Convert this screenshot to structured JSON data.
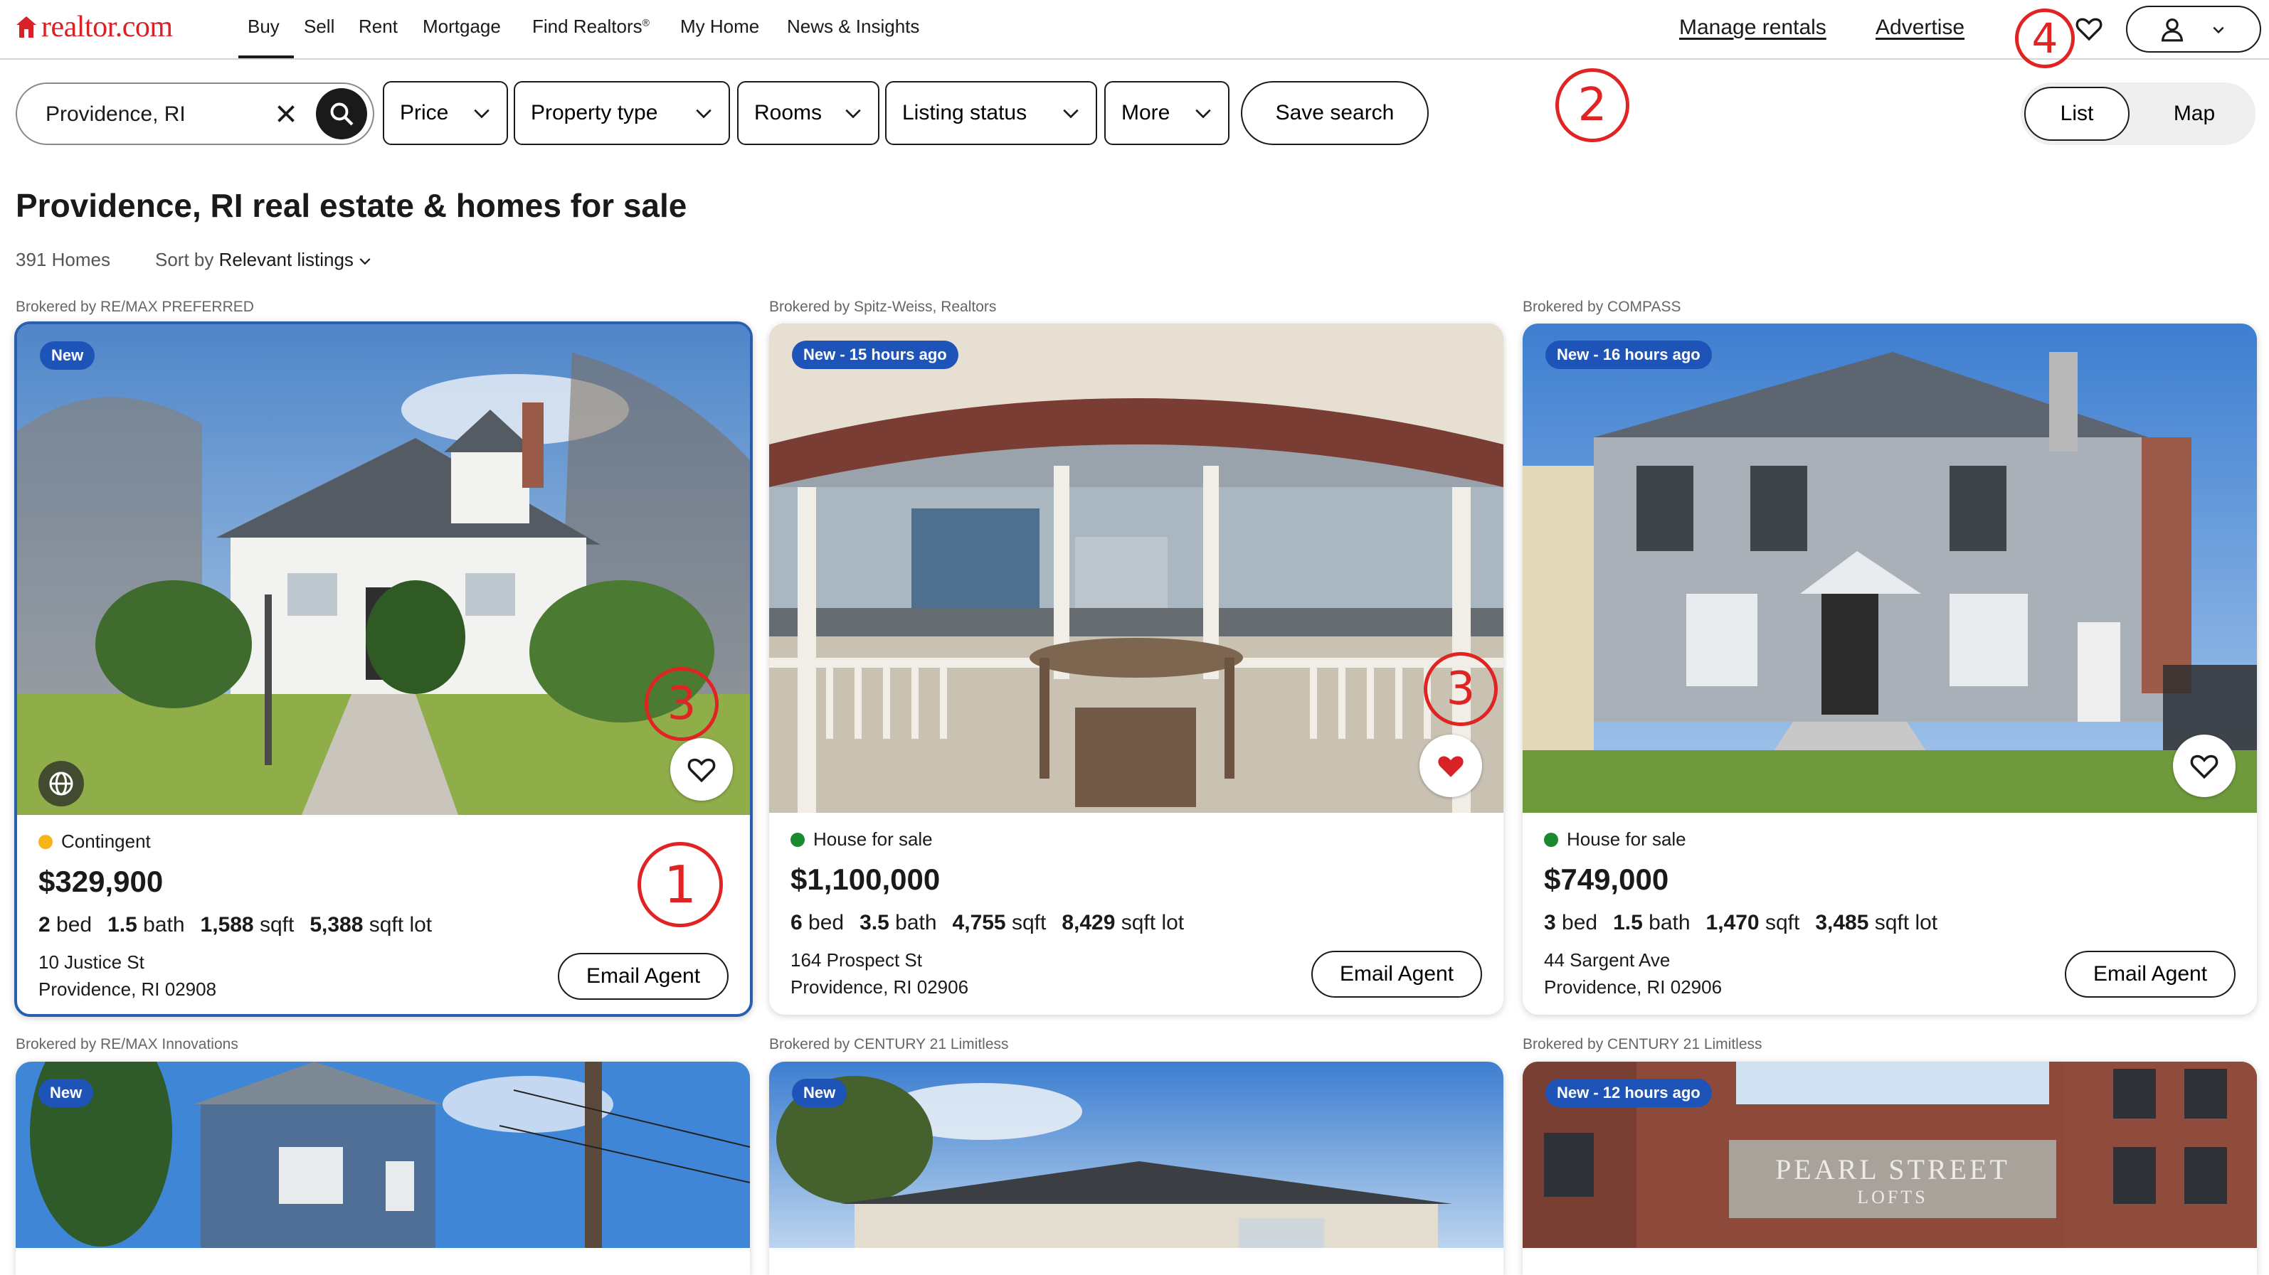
{
  "header": {
    "logo_text": "realtor.com",
    "nav": [
      "Buy",
      "Sell",
      "Rent",
      "Mortgage",
      "Find Realtors",
      "My Home",
      "News & Insights"
    ],
    "find_realtors_mark": "®",
    "manage_rentals": "Manage rentals",
    "advertise": "Advertise"
  },
  "search": {
    "value": "Providence, RI",
    "filters": [
      "Price",
      "Property type",
      "Rooms",
      "Listing status",
      "More"
    ],
    "save_label": "Save search",
    "view_list": "List",
    "view_map": "Map"
  },
  "results": {
    "title": "Providence, RI real estate & homes for sale",
    "count": "391 Homes",
    "sort_prefix": "Sort by",
    "sort_value": "Relevant listings"
  },
  "annotations": [
    "1",
    "2",
    "3",
    "3",
    "4"
  ],
  "listings": [
    {
      "broker": "Brokered by RE/MAX PREFERRED",
      "badge": "New",
      "status": "Contingent",
      "status_color": "#f5b516",
      "price": "$329,900",
      "beds": "2",
      "beds_unit": "bed",
      "baths": "1.5",
      "baths_unit": "bath",
      "sqft": "1,588",
      "sqft_unit": "sqft",
      "lot": "5,388",
      "lot_unit": "sqft lot",
      "street": "10 Justice St",
      "city": "Providence, RI 02908",
      "email_label": "Email Agent",
      "saved": false
    },
    {
      "broker": "Brokered by Spitz-Weiss, Realtors",
      "badge": "New - 15 hours ago",
      "status": "House for sale",
      "status_color": "#1a8a2e",
      "price": "$1,100,000",
      "beds": "6",
      "beds_unit": "bed",
      "baths": "3.5",
      "baths_unit": "bath",
      "sqft": "4,755",
      "sqft_unit": "sqft",
      "lot": "8,429",
      "lot_unit": "sqft lot",
      "street": "164 Prospect St",
      "city": "Providence, RI 02906",
      "email_label": "Email Agent",
      "saved": true
    },
    {
      "broker": "Brokered by COMPASS",
      "badge": "New - 16 hours ago",
      "status": "House for sale",
      "status_color": "#1a8a2e",
      "price": "$749,000",
      "beds": "3",
      "beds_unit": "bed",
      "baths": "1.5",
      "baths_unit": "bath",
      "sqft": "1,470",
      "sqft_unit": "sqft",
      "lot": "3,485",
      "lot_unit": "sqft lot",
      "street": "44 Sargent Ave",
      "city": "Providence, RI 02906",
      "email_label": "Email Agent",
      "saved": false
    }
  ],
  "second_row": [
    {
      "broker": "Brokered by RE/MAX Innovations",
      "badge": "New"
    },
    {
      "broker": "Brokered by CENTURY 21 Limitless",
      "badge": "New"
    },
    {
      "broker": "Brokered by CENTURY 21 Limitless",
      "badge": "New - 12 hours ago",
      "sign_line1": "PEARL STREET",
      "sign_line2": "LOFTS"
    }
  ],
  "colors": {
    "brand": "#d92228",
    "badge": "#1e54b7",
    "annotation": "#e02424",
    "saved_heart": "#d92228"
  },
  "icons": [
    "house-logo-icon",
    "search-icon",
    "close-icon",
    "chevron-down-icon",
    "heart-icon",
    "user-icon",
    "globe-icon"
  ]
}
